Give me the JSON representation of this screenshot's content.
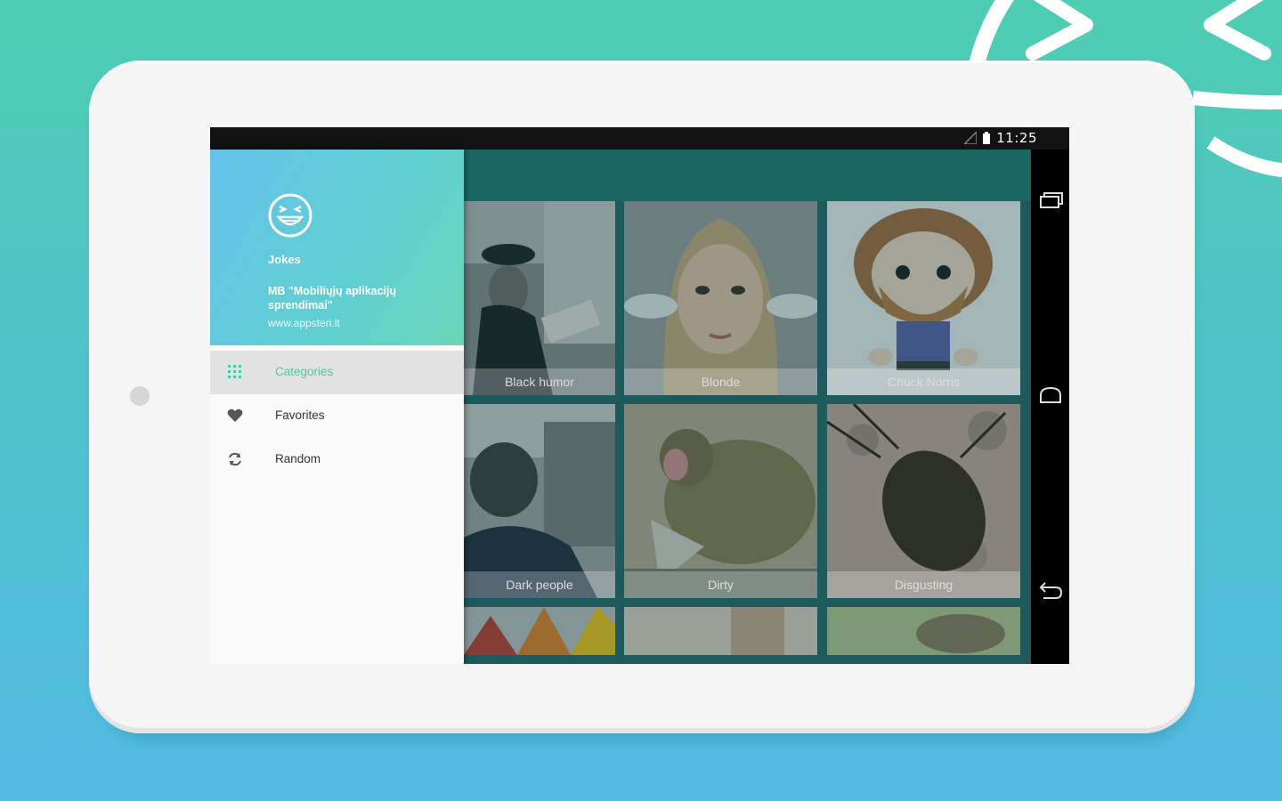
{
  "status_bar": {
    "time": "11:25"
  },
  "drawer": {
    "app_name": "Jokes",
    "company": "MB \"Mobiliųjų aplikacijų sprendimai\"",
    "website": "www.appsteri.lt",
    "menu": [
      {
        "label": "Categories",
        "icon": "grid-icon",
        "active": true
      },
      {
        "label": "Favorites",
        "icon": "heart-icon",
        "active": false
      },
      {
        "label": "Random",
        "icon": "refresh-icon",
        "active": false
      }
    ]
  },
  "categories": [
    {
      "label": "Black humor"
    },
    {
      "label": "Blonde"
    },
    {
      "label": "Chuck Norris"
    },
    {
      "label": "Dark people"
    },
    {
      "label": "Dirty"
    },
    {
      "label": "Disgusting"
    }
  ],
  "colors": {
    "background_top": "#4ecdb2",
    "background_bottom": "#52bbe3",
    "accent": "#4cc8a8",
    "toolbar": "#1b6660"
  },
  "nav_icons": [
    "recent-apps-icon",
    "home-icon",
    "back-icon"
  ]
}
